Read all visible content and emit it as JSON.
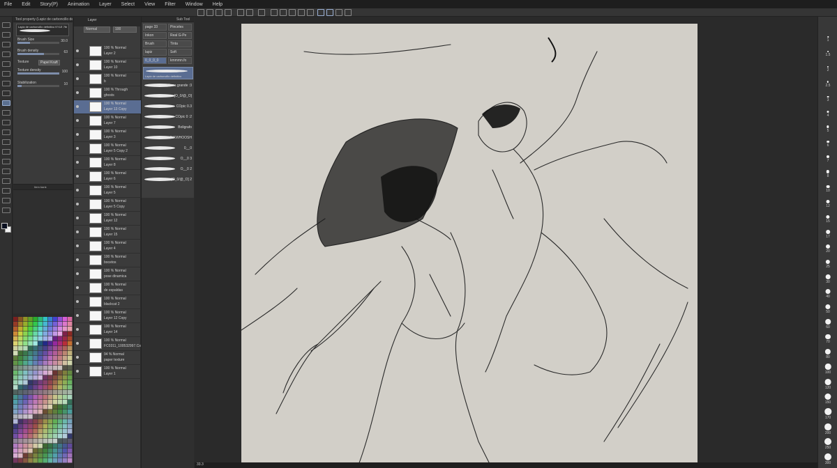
{
  "menu": [
    "File",
    "Edit",
    "Story(P)",
    "Animation",
    "Layer",
    "Select",
    "View",
    "Filter",
    "Window",
    "Help"
  ],
  "tool_property": {
    "tab": "Tool property (Lapiz de carboncillo definitivo)",
    "brush_name": "Lapiz de carboncillo definitivo KYLE 7th",
    "brush_size_label": "Brush Size",
    "brush_size_value": "30.0",
    "brush_density_label": "Brush density",
    "brush_density_value": "63",
    "brush_density_fraction": 0.63,
    "texture_label": "Texture",
    "texture_value": "Papel Kraft",
    "texture_density_label": "Texture density",
    "texture_density_value": "100",
    "stabilization_label": "Stabilization",
    "stabilization_value": "10"
  },
  "nav_tab": "Item bank",
  "layer_panel": {
    "tab": "Layer",
    "blend_mode": "Normal",
    "opacity": "100",
    "layers": [
      {
        "mode": "100 % Normal",
        "name": "Layer 2"
      },
      {
        "mode": "100 % Normal",
        "name": "Layer 10"
      },
      {
        "mode": "100 % Normal",
        "name": "b"
      },
      {
        "mode": "100 % Through",
        "name": "ghosts"
      },
      {
        "mode": "100 % Normal",
        "name": "Layer 13 Copy"
      },
      {
        "mode": "100 % Normal",
        "name": "Layer 7"
      },
      {
        "mode": "100 % Normal",
        "name": "Layer 3"
      },
      {
        "mode": "100 % Normal",
        "name": "Layer 5 Copy 2"
      },
      {
        "mode": "100 % Normal",
        "name": "Layer 8"
      },
      {
        "mode": "100 % Normal",
        "name": "Layer 6"
      },
      {
        "mode": "100 % Normal",
        "name": "Layer 5"
      },
      {
        "mode": "100 % Normal",
        "name": "Layer 5 Copy"
      },
      {
        "mode": "100 % Normal",
        "name": "Layer 12"
      },
      {
        "mode": "100 % Normal",
        "name": "Layer 15"
      },
      {
        "mode": "100 % Normal",
        "name": "Layer 4"
      },
      {
        "mode": "100 % Normal",
        "name": "bocetos"
      },
      {
        "mode": "100 % Normal",
        "name": "pose dinamica"
      },
      {
        "mode": "100 % Normal",
        "name": "de espaldas"
      },
      {
        "mode": "100 % Normal",
        "name": "blackcat 2"
      },
      {
        "mode": "100 % Normal",
        "name": "Layer 12 Copy"
      },
      {
        "mode": "100 % Normal",
        "name": "Layer 14"
      },
      {
        "mode": "100 % Normal",
        "name": "FC0311_100532997.Co"
      },
      {
        "mode": "94 % Normal",
        "name": "paper texture"
      },
      {
        "mode": "100 % Normal",
        "name": "Layer 1"
      }
    ]
  },
  "sub_tool": {
    "tab": "Sub Tool",
    "tools": [
      "page 33",
      "Pinceles",
      "Inkon",
      "Real G-Pe",
      "Brush",
      "Tinta",
      "lapiz",
      "Soft",
      "0_0_0_0",
      "kmmmn.fo"
    ],
    "selected_brush": "Lapiz de carboncillo definitivo",
    "brushes": [
      "pluma grande :3",
      "[O_0/@_O]",
      "COpic 0.3",
      "COpic 0 :2",
      "Boligrafo",
      "INKWHOOSH",
      "0__0",
      "O__0 3",
      "O__0 2",
      "[O_0/@_O] 2"
    ]
  },
  "status": {
    "zoom": "33.3"
  },
  "brush_size_panel": {
    "sizes": [
      "1",
      "1.5",
      "2",
      "2.5",
      "3",
      "4",
      "5",
      "6",
      "7",
      "8",
      "10",
      "12",
      "15",
      "17",
      "20",
      "25",
      "30",
      "40",
      "50",
      "60",
      "70",
      "80",
      "100",
      "120",
      "150",
      "170",
      "200",
      "250",
      "300"
    ]
  },
  "colors": {
    "accent": "#5a6d92",
    "paper": "#d2cfc8",
    "foreground_color": "#0a1020",
    "background_color": "#f0f0f0"
  }
}
